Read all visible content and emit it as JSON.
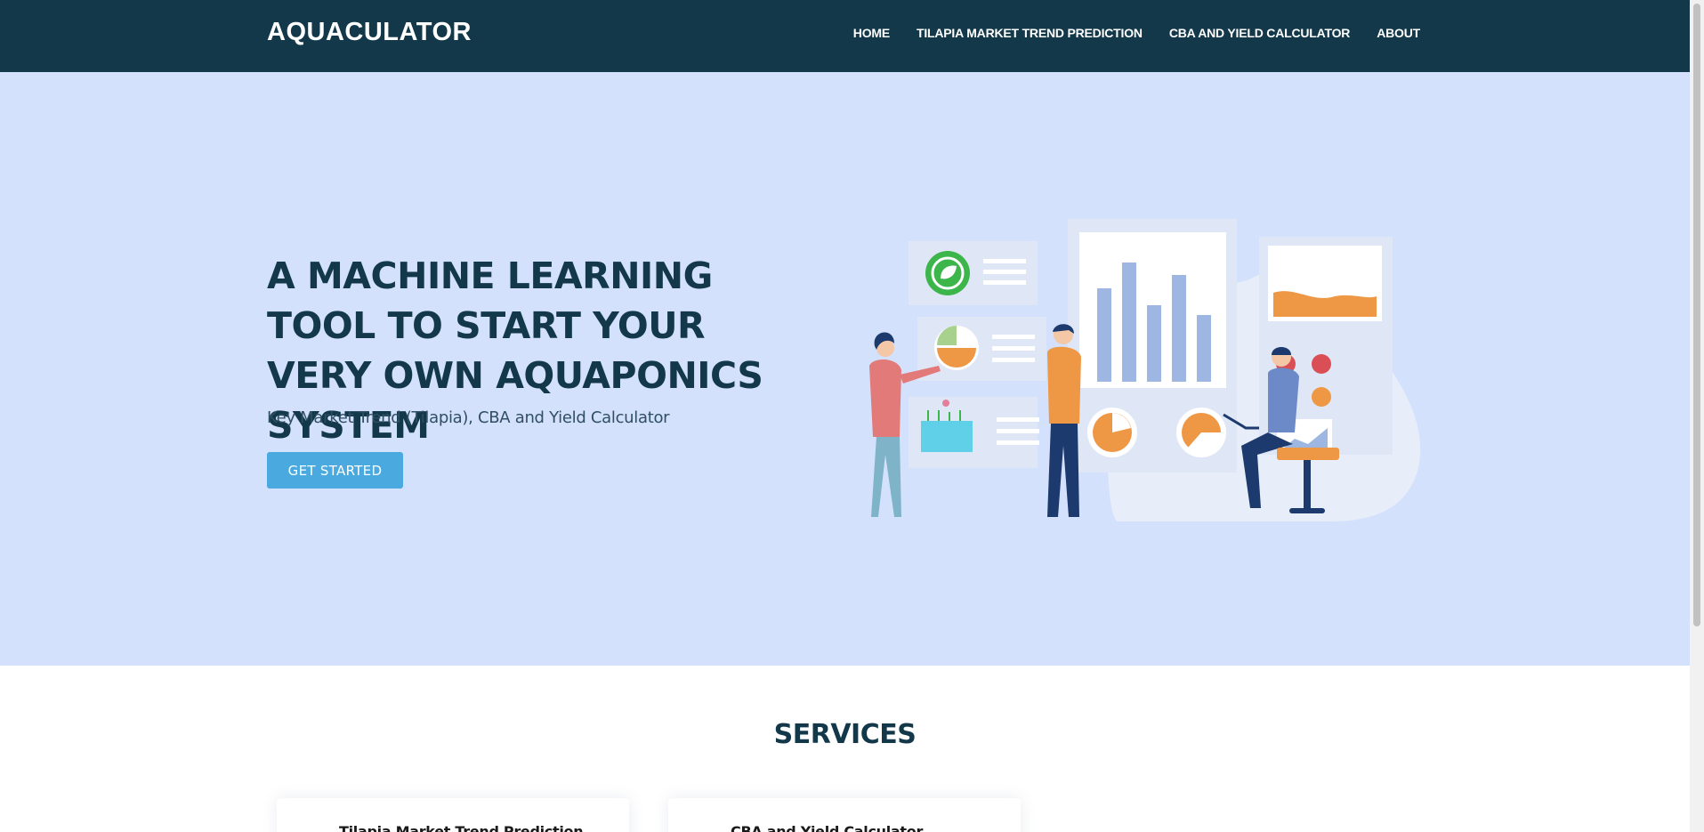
{
  "header": {
    "logo": "AQUACULATOR",
    "nav": [
      {
        "label": "HOME"
      },
      {
        "label": "TILAPIA MARKET TREND PREDICTION"
      },
      {
        "label": "CBA AND YIELD CALCULATOR"
      },
      {
        "label": "ABOUT"
      }
    ]
  },
  "hero": {
    "title": "A MACHINE LEARNING TOOL TO START YOUR VERY OWN AQUAPONICS SYSTEM",
    "subtitle": "Key Market Trend (Tilapia), CBA and Yield Calculator",
    "cta_label": "GET STARTED"
  },
  "services": {
    "title": "SERVICES",
    "cards": [
      {
        "title": "Tilapia Market Trend Prediction"
      },
      {
        "title": "CBA and Yield Calculator"
      }
    ]
  },
  "colors": {
    "header_bg": "#12384a",
    "hero_bg": "#d4e1fc",
    "accent": "#4aa9de",
    "orange": "#ee9745",
    "chart_blue": "#9db7e2"
  }
}
